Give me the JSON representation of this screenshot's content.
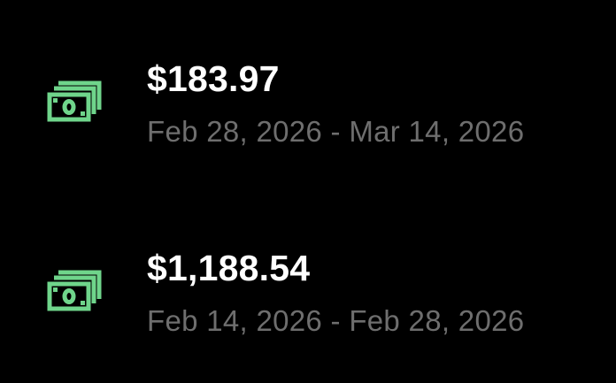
{
  "theme": {
    "background": "#000000",
    "amount_color": "#ffffff",
    "date_color": "#6e6e6e",
    "icon_color": "#6fd58b"
  },
  "payouts": [
    {
      "icon": "money-icon",
      "amount": "$183.97",
      "period": "Feb 28, 2026 - Mar 14, 2026"
    },
    {
      "icon": "money-icon",
      "amount": "$1,188.54",
      "period": "Feb 14, 2026 - Feb 28, 2026"
    }
  ]
}
